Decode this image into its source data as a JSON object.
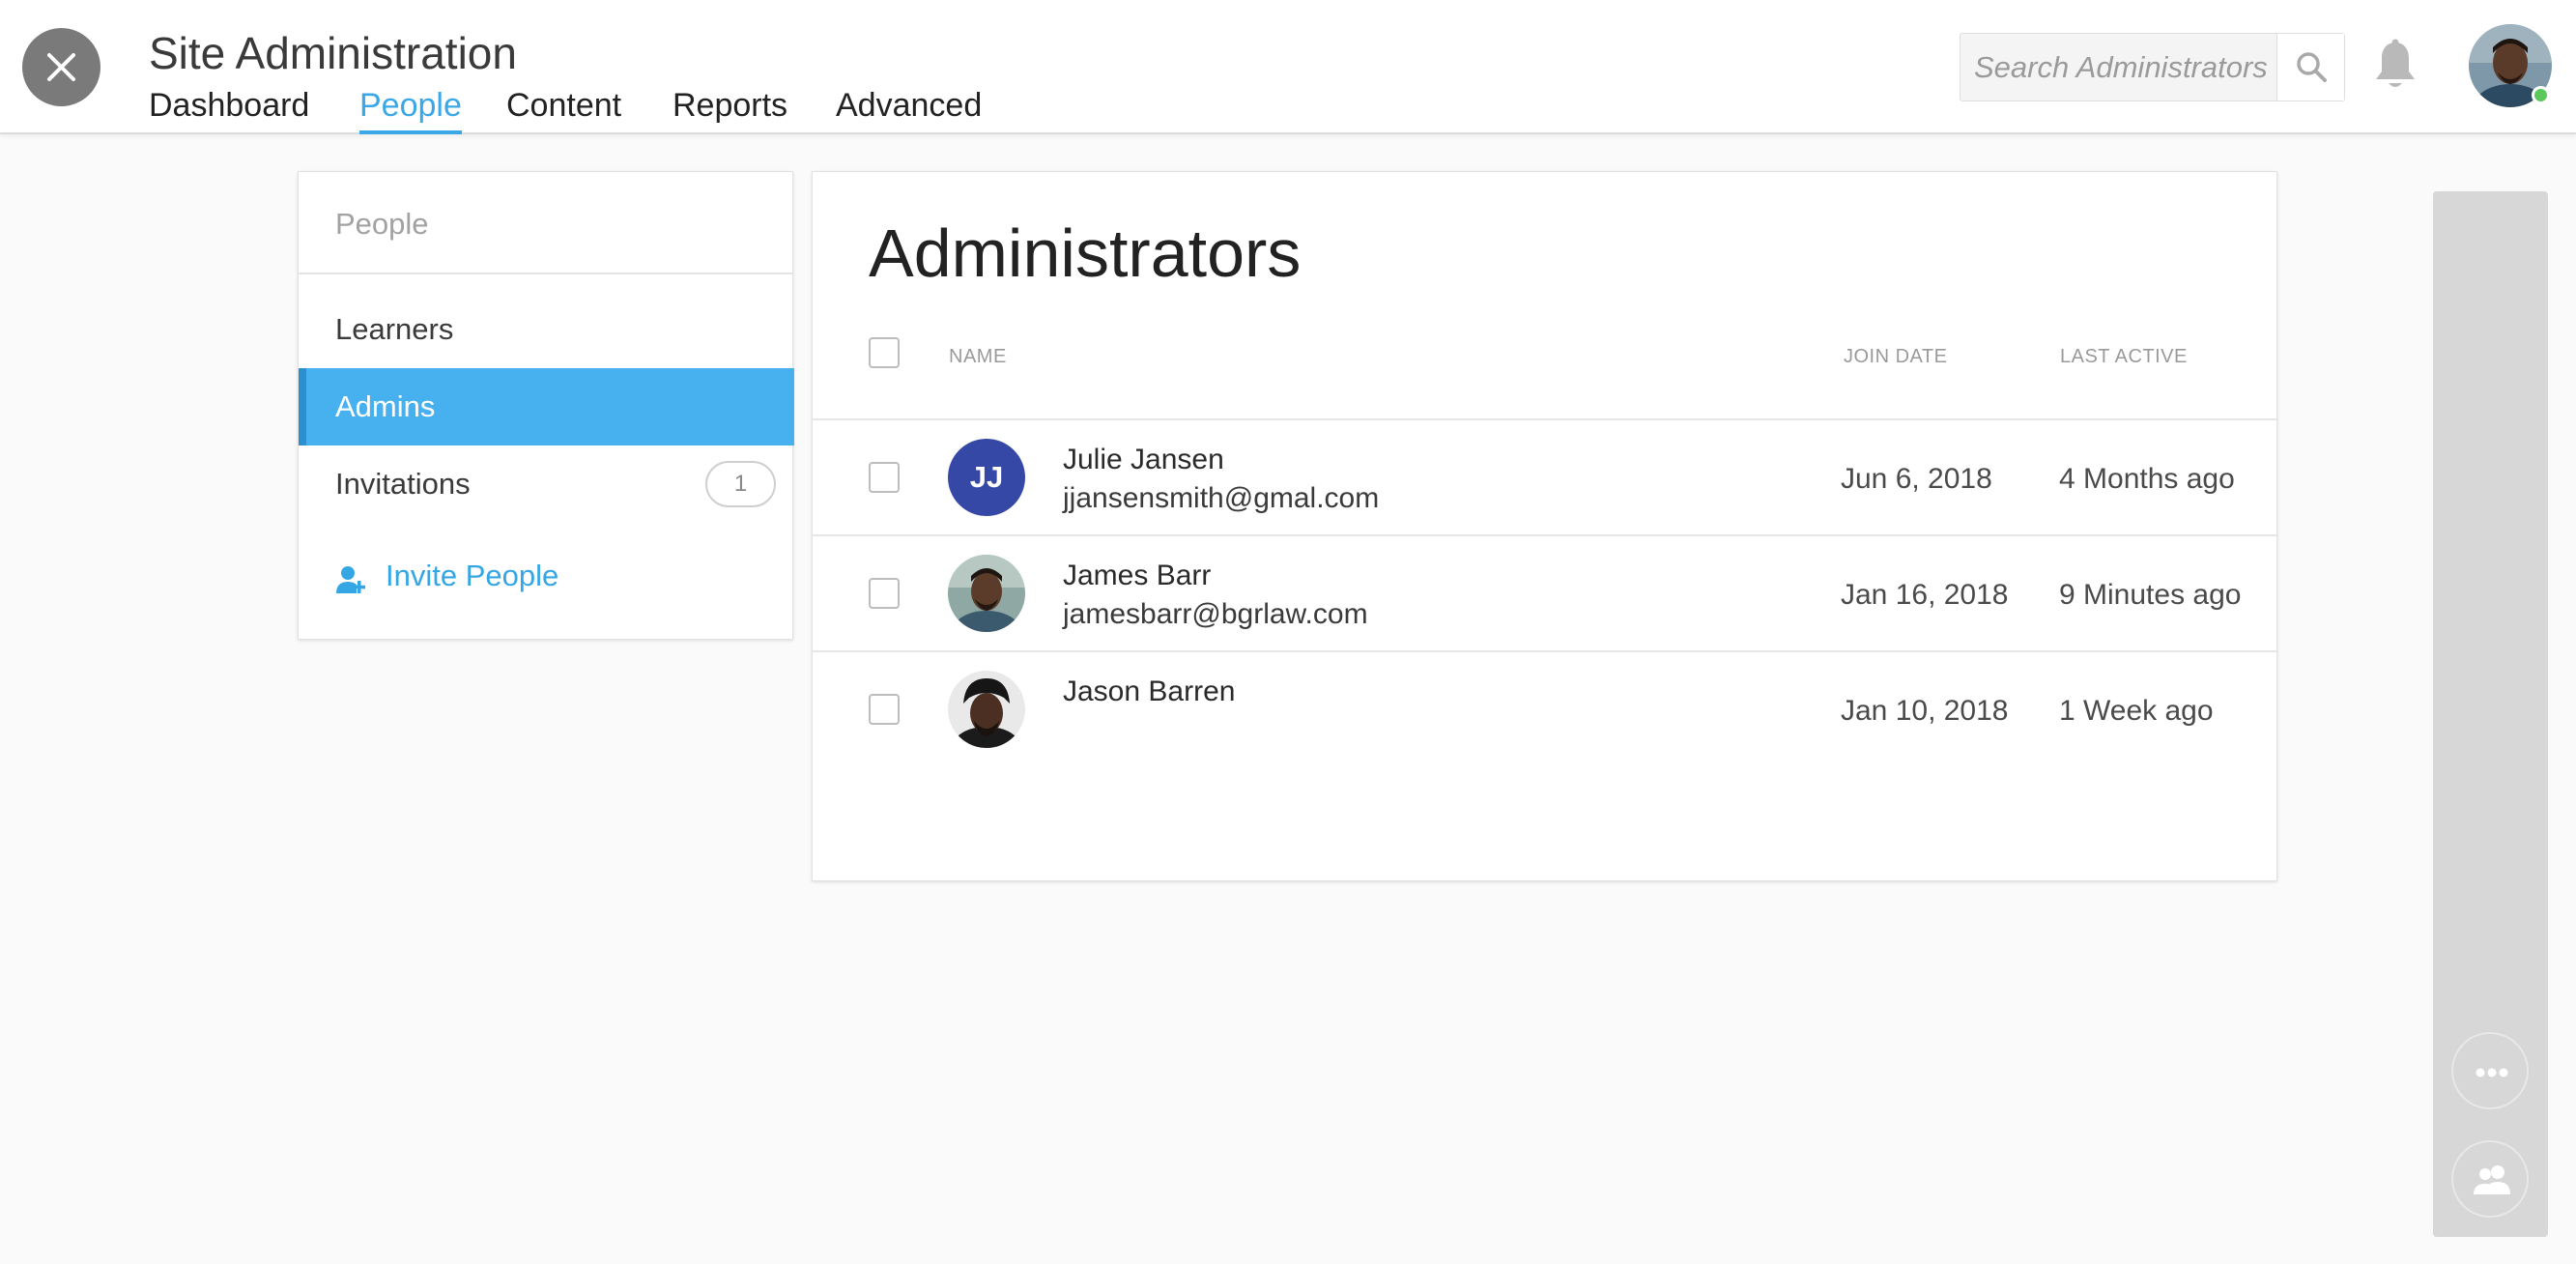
{
  "header": {
    "title": "Site Administration",
    "close_icon": "close-icon",
    "nav": [
      {
        "label": "Dashboard",
        "active": false
      },
      {
        "label": "People",
        "active": true
      },
      {
        "label": "Content",
        "active": false
      },
      {
        "label": "Reports",
        "active": false
      },
      {
        "label": "Advanced",
        "active": false
      }
    ],
    "search": {
      "placeholder": "Search Administrators",
      "value": "",
      "icon": "search-icon"
    },
    "notification_icon": "bell-icon",
    "user_status": "online"
  },
  "sidebar": {
    "heading": "People",
    "items": [
      {
        "label": "Learners",
        "active": false,
        "badge": null
      },
      {
        "label": "Admins",
        "active": true,
        "badge": null
      },
      {
        "label": "Invitations",
        "active": false,
        "badge": "1"
      }
    ],
    "invite_label": "Invite People",
    "invite_icon": "add-person-icon"
  },
  "main": {
    "title": "Administrators",
    "columns": {
      "name": "NAME",
      "join_date": "JOIN DATE",
      "last_active": "LAST ACTIVE"
    },
    "rows": [
      {
        "initials": "JJ",
        "name": "Julie Jansen",
        "email": "jjansensmith@gmal.com",
        "join_date": "Jun 6, 2018",
        "last_active": "4 Months ago"
      },
      {
        "initials": "",
        "name": "James Barr",
        "email": "jamesbarr@bgrlaw.com",
        "join_date": "Jan 16, 2018",
        "last_active": "9 Minutes ago"
      },
      {
        "initials": "",
        "name": "Jason Barren",
        "email": "",
        "join_date": "Jan 10, 2018",
        "last_active": "1 Week ago"
      }
    ]
  },
  "rail": {
    "buttons": [
      "more-icon",
      "group-icon"
    ]
  },
  "colors": {
    "accent": "#3aa8e6",
    "sidebar_active": "#47b1ef",
    "initials_avatar": "#3548a6",
    "online": "#5cc75a"
  }
}
